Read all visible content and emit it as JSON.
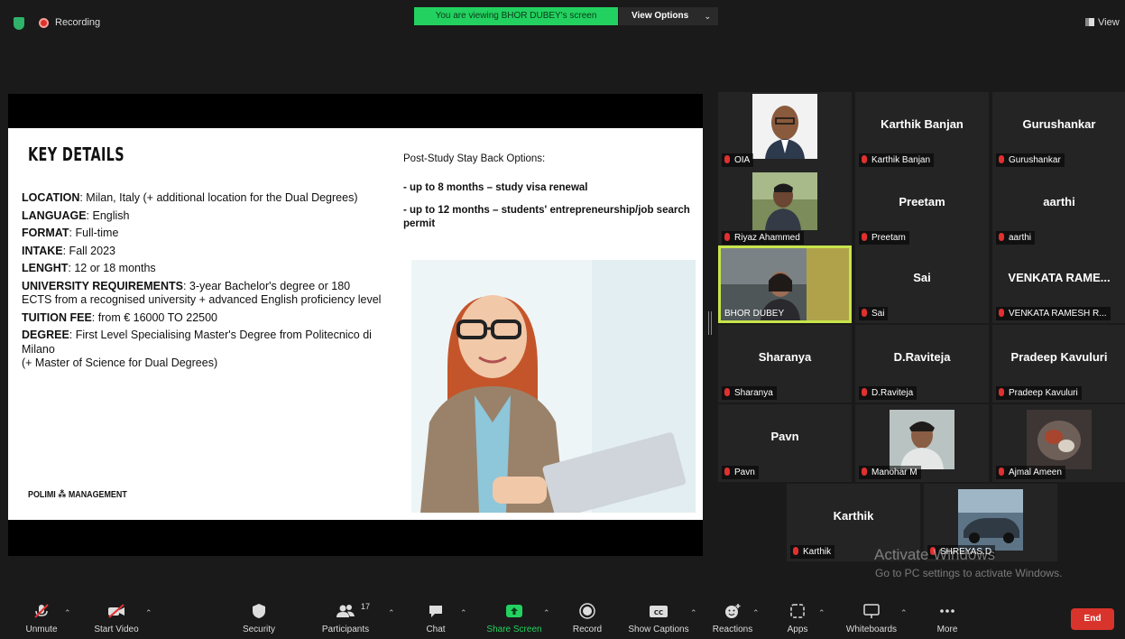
{
  "top": {
    "recording_label": "Recording",
    "viewing_banner": "You are viewing BHOR DUBEY's screen",
    "view_options_label": "View Options",
    "view_label": "View"
  },
  "slide": {
    "title": "KEY DETAILS",
    "details": [
      {
        "label": "LOCATION",
        "value": ": Milan, Italy (+ additional location for the Dual Degrees)"
      },
      {
        "label": "LANGUAGE",
        "value": ": English"
      },
      {
        "label": "FORMAT",
        "value": ": Full-time"
      },
      {
        "label": "INTAKE",
        "value": ": Fall 2023"
      },
      {
        "label": "LENGHT",
        "value": ": 12 or 18 months"
      },
      {
        "label": "UNIVERSITY REQUIREMENTS",
        "value": ": 3-year Bachelor's degree or 180 ECTS from a recognised university + advanced English proficiency level"
      },
      {
        "label": "TUITION FEE",
        "value": ": from € 16000 TO 22500"
      },
      {
        "label": "DEGREE",
        "value": ": First Level Specialising Master's Degree from Politecnico di Milano"
      }
    ],
    "degree_note": "(+ Master of Science for Dual Degrees)",
    "post_study_title": "Post-Study Stay Back Options:",
    "post_study_items": [
      "- up to 8 months – study visa renewal",
      "- up to 12 months – students' entrepreneurship/job search permit"
    ],
    "logo_text": "POLIMI ⁂ MANAGEMENT"
  },
  "participants": [
    {
      "big": "",
      "label": "OIA"
    },
    {
      "big": "Karthik Banjan",
      "label": "Karthik Banjan"
    },
    {
      "big": "Gurushankar",
      "label": "Gurushankar"
    },
    {
      "big": "",
      "label": "Riyaz Ahammed"
    },
    {
      "big": "Preetam",
      "label": "Preetam"
    },
    {
      "big": "aarthi",
      "label": "aarthi"
    },
    {
      "big": "",
      "label": "BHOR DUBEY"
    },
    {
      "big": "Sai",
      "label": "Sai"
    },
    {
      "big": "VENKATA RAME...",
      "label": "VENKATA RAMESH R..."
    },
    {
      "big": "Sharanya",
      "label": "Sharanya"
    },
    {
      "big": "D.Raviteja",
      "label": "D.Raviteja"
    },
    {
      "big": "Pradeep Kavuluri",
      "label": "Pradeep Kavuluri"
    },
    {
      "big": "Pavn",
      "label": "Pavn"
    },
    {
      "big": "",
      "label": "Manohar M"
    },
    {
      "big": "",
      "label": "Ajmal Ameen"
    },
    {
      "big": "Karthik",
      "label": "Karthik"
    },
    {
      "big": "",
      "label": "SHREYAS.D"
    }
  ],
  "watermark": {
    "line1": "Activate Windows",
    "line2": "Go to PC settings to activate Windows."
  },
  "toolbar": {
    "unmute": "Unmute",
    "start_video": "Start Video",
    "security": "Security",
    "participants": "Participants",
    "participants_count": "17",
    "chat": "Chat",
    "share_screen": "Share Screen",
    "record": "Record",
    "show_captions": "Show Captions",
    "reactions": "Reactions",
    "apps": "Apps",
    "whiteboards": "Whiteboards",
    "more": "More",
    "end": "End"
  },
  "colors": {
    "active_speaker_outline": "#c7e54b",
    "banner_green": "#23d160",
    "end_red": "#d9342b",
    "share_screen_green": "#23d160"
  }
}
